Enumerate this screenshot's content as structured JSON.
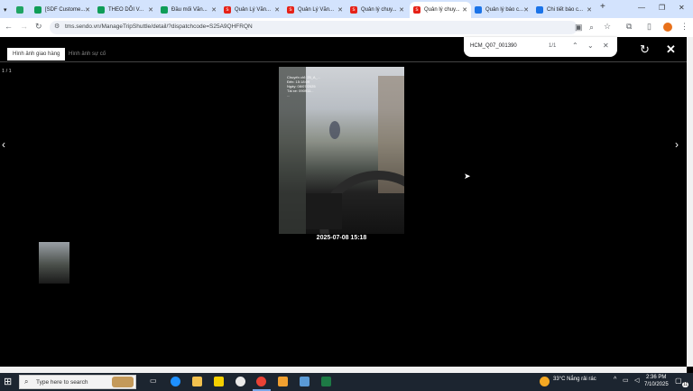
{
  "browser": {
    "tabs": [
      {
        "title": "",
        "icon": "google-drive-icon",
        "color": "#1fa463"
      },
      {
        "title": "[SDF Custome...",
        "icon": "sheets-icon",
        "color": "#0f9d58"
      },
      {
        "title": "THEO DÕI V...",
        "icon": "sheets-icon",
        "color": "#0f9d58"
      },
      {
        "title": "Đầu mối Văn...",
        "icon": "sheets-icon",
        "color": "#0f9d58"
      },
      {
        "title": "Quản Lý Văn...",
        "icon": "sendo-icon",
        "color": "#e62117"
      },
      {
        "title": "Quản Lý Văn...",
        "icon": "sendo-icon",
        "color": "#e62117"
      },
      {
        "title": "Quản lý chuy...",
        "icon": "sendo-icon",
        "color": "#e62117"
      },
      {
        "title": "Quản lý chuy...",
        "icon": "sendo-icon",
        "color": "#e62117"
      },
      {
        "title": "Quản lý báo c...",
        "icon": "globe-icon",
        "color": "#1a73e8"
      },
      {
        "title": "Chi tiết báo c...",
        "icon": "globe-icon",
        "color": "#1a73e8"
      }
    ],
    "url": "tms.sendo.vn/ManageTripShuttle/detail/?dispatchcode=S25A9QHFRQN"
  },
  "find_bar": {
    "query": "HCM_Q07_001390",
    "count": "1/1"
  },
  "viewer": {
    "tabs": [
      "Hình ảnh giao hàng",
      "Hình ảnh sự cố"
    ],
    "counter": "1 / 1",
    "caption": "2025-07-08 15:18",
    "watermark": [
      "Chuyến chỉ: 25_A_...",
      "Đến: 15:18:09",
      "Ngày: 08/07/2025",
      "Tài xe: 090911...",
      "..."
    ]
  },
  "taskbar": {
    "search_placeholder": "Type here to search",
    "weather": "33°C  Nắng rải rác",
    "time": "2:36 PM",
    "date": "7/10/2025",
    "notifications": "11"
  }
}
